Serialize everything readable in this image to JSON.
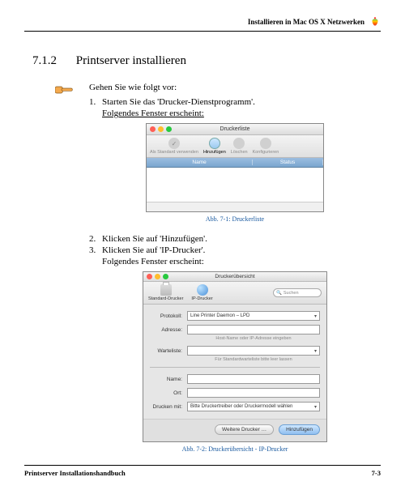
{
  "header": {
    "text": "Installieren in Mac OS X Netzwerken"
  },
  "section": {
    "number": "7.1.2",
    "title": "Printserver installieren"
  },
  "intro": "Gehen Sie wie folgt vor:",
  "steps": {
    "s1": {
      "num": "1.",
      "text": "Starten Sie das 'Drucker-Dienstprogramm'."
    },
    "s1b": "Folgendes Fenster erscheint:",
    "s2": {
      "num": "2.",
      "text": "Klicken Sie auf 'Hinzufügen'."
    },
    "s3": {
      "num": "3.",
      "text": "Klicken Sie auf 'IP-Drucker'."
    },
    "s3b": "Folgendes Fenster erscheint:"
  },
  "fig1": {
    "title": "Druckerliste",
    "toolbar": {
      "default": "Als Standard verwenden",
      "add": "Hinzufügen",
      "delete": "Löschen",
      "config": "Konfigurieren"
    },
    "cols": {
      "name": "Name",
      "status": "Status"
    },
    "caption": "Abb. 7-1: Druckerliste"
  },
  "fig2": {
    "title": "Druckerübersicht",
    "toolbar": {
      "std": "Standard-Drucker",
      "ip": "IP-Drucker",
      "search": "Suchen"
    },
    "labels": {
      "protokoll": "Protokoll:",
      "adresse": "Adresse:",
      "warteliste": "Warteliste:",
      "name": "Name:",
      "ort": "Ort:",
      "drucken": "Drucken mit:"
    },
    "values": {
      "protokoll": "Line Printer Daemon – LPD",
      "adresse_hint": "Host-Name oder IP-Adresse eingeben",
      "warteliste_hint": "Für Standardwarteliste bitte leer lassen",
      "drucken": "Bitte Druckertreiber oder Druckermodell wählen"
    },
    "buttons": {
      "more": "Weitere Drucker …",
      "add": "Hinzufügen"
    },
    "caption": "Abb. 7-2: Druckerübersicht - IP-Drucker"
  },
  "footer": {
    "left": "Printserver Installationshandbuch",
    "right": "7-3"
  }
}
